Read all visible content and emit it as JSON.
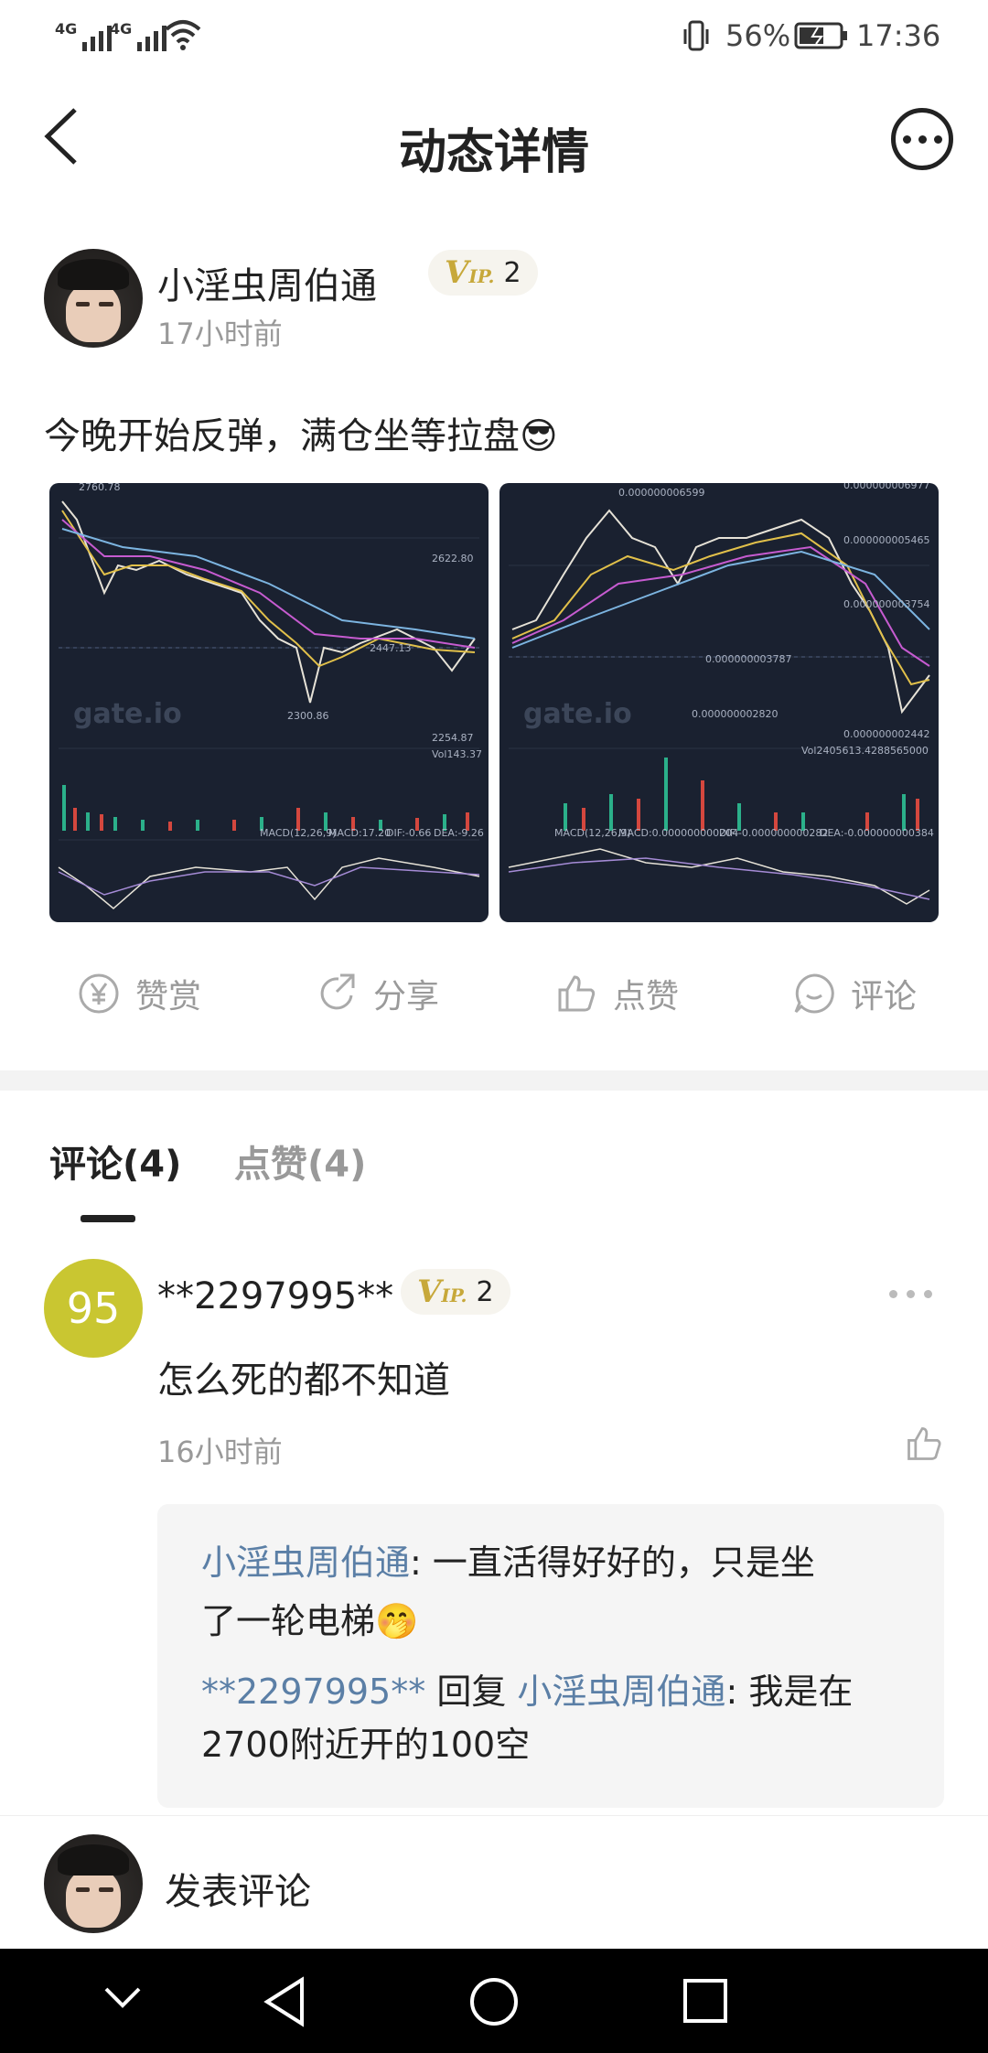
{
  "status_bar": {
    "net1": "4G",
    "net2": "4G",
    "battery": "56%",
    "time": "17:36"
  },
  "header": {
    "title": "动态详情"
  },
  "post": {
    "author": "小淫虫周伯通",
    "vip_prefix": "V",
    "vip_suffix": "IP.",
    "vip_level": "2",
    "time": "17小时前",
    "content": "今晚开始反弹，满仓坐等拉盘😎"
  },
  "charts": [
    {
      "labels": [
        "2760.78",
        "2622.80",
        "2447.13",
        "2300.86",
        "2254.87",
        "Vol143.37",
        "MACD(12,26,9)",
        "MACD:17.20",
        "DIF:-0.66",
        "DEA:-9.26"
      ],
      "watermark": "gate.io"
    },
    {
      "labels": [
        "0.000000006599",
        "0.000000005465",
        "0.000000003787",
        "0.000000003754",
        "0.000000002820",
        "0.000000002442",
        "Vol2405613.4288565000",
        "MACD(12,26,9)",
        "MACD:0.000000000204",
        "DIF:-0.000000000282",
        "DEA:-0.000000000384",
        "0.000000006977"
      ],
      "watermark": "gate.io"
    }
  ],
  "actions": {
    "reward": "赞赏",
    "share": "分享",
    "like": "点赞",
    "comment": "评论"
  },
  "tabs": {
    "comments": "评论(4)",
    "likes": "点赞(4)"
  },
  "comment": {
    "avatar_text": "95",
    "user": "**2297995**",
    "vip_level": "2",
    "text": "怎么死的都不知道",
    "time": "16小时前",
    "replies": [
      {
        "from": "小淫虫周伯通",
        "sep": ": ",
        "text": "一直活得好好的，只是坐",
        "text2": "了一轮电梯🤭"
      },
      {
        "from": "**2297995**",
        "verb": " 回复 ",
        "to": "小淫虫周伯通",
        "sep": ": ",
        "text": "我是在",
        "text2": "2700附近开的100空"
      }
    ]
  },
  "composer": {
    "placeholder": "发表评论"
  },
  "colors": {
    "link": "#5b7fa6",
    "vip_gold": "#c7a83a",
    "comment_avatar_bg": "#c9c631",
    "chart_bg": "#1a2130"
  }
}
